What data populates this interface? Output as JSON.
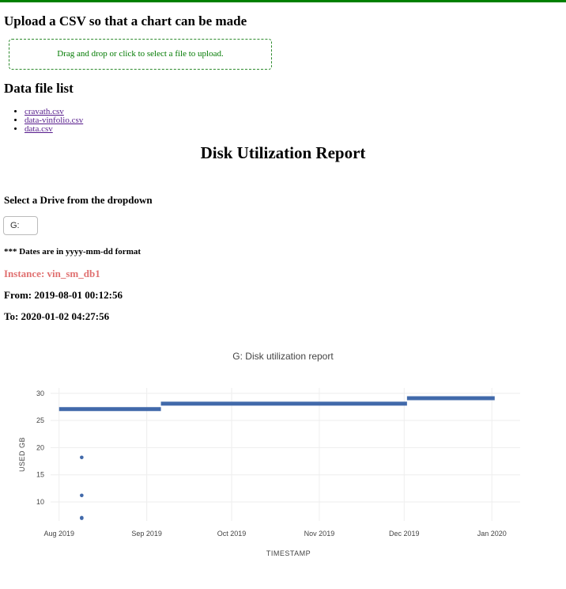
{
  "upload": {
    "title": "Upload a CSV so that a chart can be made",
    "dropzone_text": "Drag and drop or click to select a file to upload."
  },
  "file_list": {
    "title": "Data file list",
    "files": [
      "cravath.csv",
      "data-vinfolio.csv",
      "data.csv"
    ]
  },
  "report": {
    "title": "Disk Utilization Report",
    "drive_label": "Select a Drive from the dropdown",
    "drive_selected": "G:",
    "dates_note": "*** Dates are in yyyy-mm-dd format",
    "instance": "Instance: vin_sm_db1",
    "from": "From: 2019-08-01 00:12:56",
    "to": "To: 2020-01-02 04:27:56"
  },
  "colors": {
    "accent_green": "#008000",
    "instance_text": "#e07070",
    "series": "#4169aa"
  },
  "chart_data": {
    "type": "scatter",
    "title": "G: Disk utilization report",
    "xlabel": "TIMESTAMP",
    "ylabel": "USED GB",
    "x_ticks": [
      "Aug 2019",
      "Sep 2019",
      "Oct 2019",
      "Nov 2019",
      "Dec 2019",
      "Jan 2020"
    ],
    "y_ticks": [
      10,
      15,
      20,
      25,
      30
    ],
    "xlim": [
      "2019-07-29",
      "2020-01-11"
    ],
    "ylim": [
      6.5,
      31
    ],
    "grid": true,
    "series": [
      {
        "segments": [
          {
            "x": [
              "2019-08-01",
              "2019-09-06"
            ],
            "y": 27.1
          },
          {
            "x": [
              "2019-09-06",
              "2019-12-02"
            ],
            "y": 28.1
          },
          {
            "x": [
              "2019-12-02",
              "2020-01-02"
            ],
            "y": 29.1
          }
        ],
        "points": [
          {
            "x": "2019-08-09",
            "y": 18.2
          },
          {
            "x": "2019-08-09",
            "y": 11.2
          },
          {
            "x": "2019-08-09",
            "y": 7.1
          },
          {
            "x": "2019-08-09",
            "y": 7.0
          }
        ]
      }
    ]
  }
}
